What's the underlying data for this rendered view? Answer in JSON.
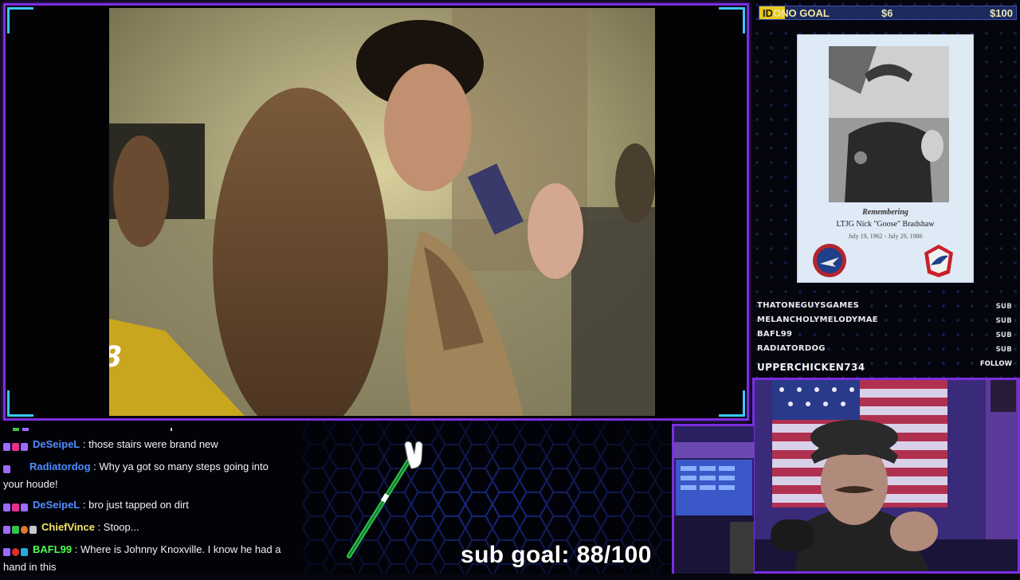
{
  "donation_goal": {
    "label_highlight": "ID",
    "label_rest": "ONO GOAL",
    "current": "$6",
    "target": "$100",
    "progress_fraction": 0.06,
    "fill_color": "#e6c91a"
  },
  "memorial": {
    "heading": "Remembering",
    "name": "LTJG Nick \"Goose\" Bradshaw",
    "dates": "July 19, 1962 - July 29, 1986"
  },
  "recent_events": [
    {
      "name": "THATONEGUYSGAMES",
      "type": "SUB"
    },
    {
      "name": "MELANCHOLYMELODYMAE",
      "type": "SUB"
    },
    {
      "name": "BAFL99",
      "type": "SUB"
    },
    {
      "name": "RADIATORDOG",
      "type": "SUB"
    }
  ],
  "latest_follower": {
    "name": "UPPERCHICKEN734",
    "type": "FOLLOW"
  },
  "chat": [
    {
      "user": "DeSeipeL",
      "color": "#4f8cff",
      "badges": [
        "#9b6bff",
        "#e8308a",
        "#9b6bff"
      ],
      "text": " : those stairs were brand new"
    },
    {
      "user": "Radiatordog",
      "color": "#4f8cff",
      "badges": [
        "#9b6bff"
      ],
      "text": " : Why ya got so many steps going into your houde!"
    },
    {
      "user": "DeSeipeL",
      "color": "#4f8cff",
      "badges": [
        "#9b6bff",
        "#e8308a",
        "#9b6bff"
      ],
      "text": " : bro just tapped on dirt"
    },
    {
      "user": "ChiefVince",
      "color": "#f4e66a",
      "badges": [
        "#9b6bff",
        "#35c24a",
        "#e07a2a",
        "#c8c8c8"
      ],
      "text": " : Stoop..."
    },
    {
      "user": "BAFL99",
      "color": "#4cff4c",
      "badges": [
        "#9b6bff",
        "#e0302a",
        "#2aa8e0"
      ],
      "text": " : Where is Johnny Knoxville. I know he had a hand in this"
    }
  ],
  "sub_goal": "sub goal: 88/100",
  "colors": {
    "accent_frame": "#7b2ee0",
    "corner_brackets": "#38c8ff"
  }
}
